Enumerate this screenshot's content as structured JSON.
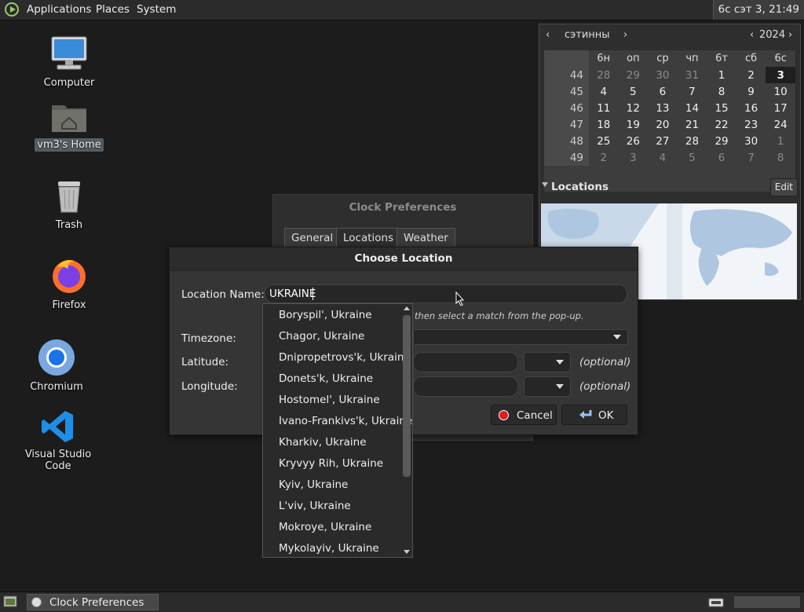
{
  "top_panel": {
    "menus": [
      "Applications",
      "Places",
      "System"
    ],
    "clock": "6с сэт  3, 21:49"
  },
  "desktop": {
    "icons": [
      {
        "label": "Computer"
      },
      {
        "label": "vm3's Home"
      },
      {
        "label": "Trash"
      },
      {
        "label": "Firefox"
      },
      {
        "label": "Chromium"
      },
      {
        "label": "Visual Studio Code"
      }
    ]
  },
  "calendar": {
    "month": "сэтинны",
    "year": "2024",
    "weekdays": [
      "6н",
      "оп",
      "ср",
      "чп",
      "6т",
      "сб",
      "6с"
    ],
    "weeks": [
      {
        "num": "44",
        "days": [
          "28",
          "29",
          "30",
          "31",
          "1",
          "2",
          "3"
        ]
      },
      {
        "num": "45",
        "days": [
          "4",
          "5",
          "6",
          "7",
          "8",
          "9",
          "10"
        ]
      },
      {
        "num": "46",
        "days": [
          "11",
          "12",
          "13",
          "14",
          "15",
          "16",
          "17"
        ]
      },
      {
        "num": "47",
        "days": [
          "18",
          "19",
          "20",
          "21",
          "22",
          "23",
          "24"
        ]
      },
      {
        "num": "48",
        "days": [
          "25",
          "26",
          "27",
          "28",
          "29",
          "30",
          "1"
        ]
      },
      {
        "num": "49",
        "days": [
          "2",
          "3",
          "4",
          "5",
          "6",
          "7",
          "8"
        ]
      }
    ],
    "locations_label": "Locations",
    "edit_label": "Edit"
  },
  "clock_prefs": {
    "title": "Clock Preferences",
    "tabs": [
      "General",
      "Locations",
      "Weather"
    ]
  },
  "dialog": {
    "title": "Choose Location",
    "location_name_label": "Location Name:",
    "location_name_value": "UKRAINE",
    "hint": "then select a match from the pop-up.",
    "timezone_label": "Timezone:",
    "latitude_label": "Latitude:",
    "longitude_label": "Longitude:",
    "optional": "(optional)",
    "cancel_label": "Cancel",
    "ok_label": "OK"
  },
  "popup": {
    "items": [
      "Boryspil', Ukraine",
      "Chagor, Ukraine",
      "Dnipropetrovs'k, Ukraine",
      "Donets'k, Ukraine",
      "Hostomel', Ukraine",
      "Ivano-Frankivs'k, Ukraine",
      "Kharkiv, Ukraine",
      "Kryvyy Rih, Ukraine",
      "Kyiv, Ukraine",
      "L'viv, Ukraine",
      "Mokroye, Ukraine",
      "Mykolayiv, Ukraine"
    ]
  },
  "bottom_panel": {
    "task_label": "Clock Preferences"
  }
}
